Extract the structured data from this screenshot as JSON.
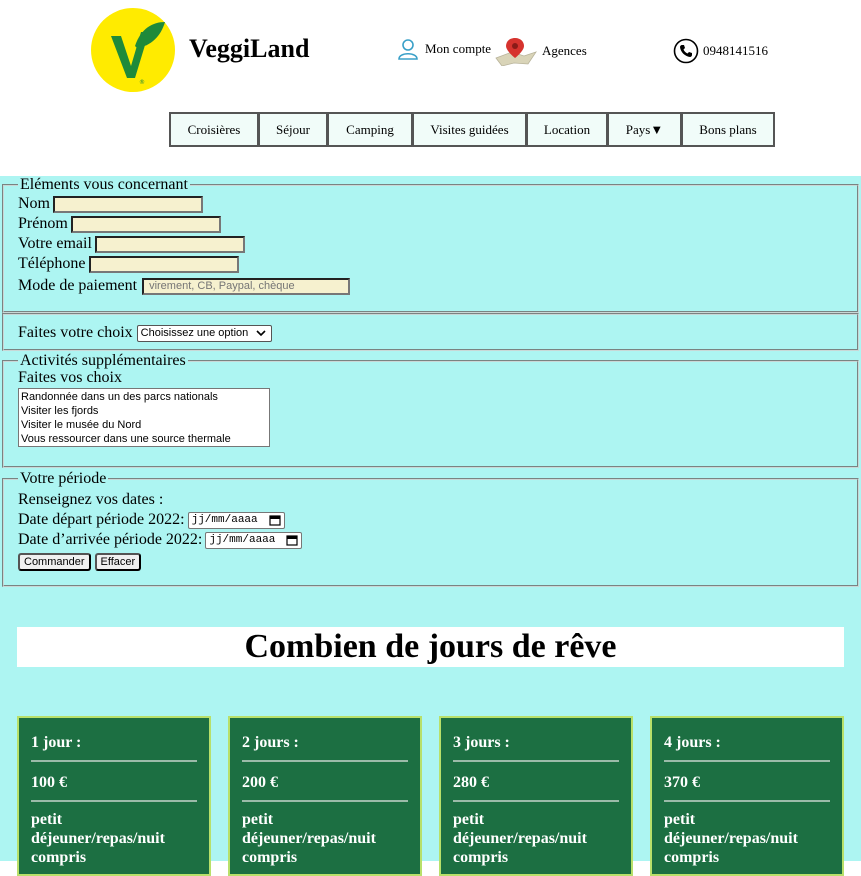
{
  "header": {
    "brand": "VeggiLand",
    "account_label": "Mon compte",
    "agencies_label": "Agences",
    "phone": "0948141516"
  },
  "nav": {
    "items": [
      "Croisières",
      "Séjour",
      "Camping",
      "Visites guidées",
      "Location",
      "Pays▼",
      "Bons plans"
    ]
  },
  "form": {
    "personal": {
      "legend": "Eléments vous concernant",
      "nom_label": "Nom",
      "prenom_label": "Prénom",
      "email_label": "Votre email",
      "tel_label": "Téléphone",
      "payment_label": "Mode de paiement",
      "payment_placeholder": "virement, CB, Paypal, chèque"
    },
    "choice": {
      "label": "Faites votre choix",
      "selected": "Choisissez une option"
    },
    "activities": {
      "legend": "Activités supplémentaires",
      "label": "Faites vos choix",
      "options": [
        "Randonnée dans un des parcs nationals",
        "Visiter les fjords",
        "Visiter le musée du Nord",
        "Vous ressourcer dans une source thermale"
      ]
    },
    "period": {
      "legend": "Votre période",
      "intro": "Renseignez vos dates :",
      "depart_label": "Date départ période 2022:",
      "arrivee_label": "Date d’arrivée période 2022:",
      "date_placeholder": "jj/mm/aaaa",
      "submit_label": "Commander",
      "reset_label": "Effacer"
    }
  },
  "pricing": {
    "title": "Combien de jours de rêve",
    "cards": [
      {
        "days": "1 jour :",
        "price": "100 €",
        "desc": "petit déjeuner/repas/nuit compris"
      },
      {
        "days": "2 jours :",
        "price": "200 €",
        "desc": "petit déjeuner/repas/nuit compris"
      },
      {
        "days": "3 jours :",
        "price": "280 €",
        "desc": "petit déjeuner/repas/nuit compris"
      },
      {
        "days": "4 jours :",
        "price": "370 €",
        "desc": "petit déjeuner/repas/nuit compris"
      }
    ]
  },
  "colors": {
    "form_bg": "#adf5f2",
    "card_bg": "#1c6f42",
    "logo_yellow": "#ffeb00",
    "logo_green": "#1f8a3a"
  }
}
